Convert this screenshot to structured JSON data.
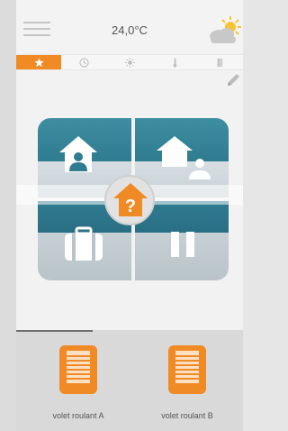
{
  "header": {
    "temperature": "24,0°C",
    "menu_icon": "hamburger-menu-icon",
    "weather_icon": "partly-sunny-icon"
  },
  "tabs": [
    {
      "icon": "star-icon",
      "active": true
    },
    {
      "icon": "clock-icon",
      "active": false
    },
    {
      "icon": "sun-icon",
      "active": false
    },
    {
      "icon": "thermometer-icon",
      "active": false
    },
    {
      "icon": "book-icon",
      "active": false
    }
  ],
  "modes": [
    {
      "icon": "house-person-icon"
    },
    {
      "icon": "house-person-away-icon"
    },
    {
      "icon": "suitcase-icon"
    },
    {
      "icon": "pause-icon"
    }
  ],
  "center": {
    "icon": "house-question-icon",
    "symbol": "?"
  },
  "devices": [
    {
      "label": "volet roulant A",
      "icon": "roller-shutter-icon"
    },
    {
      "label": "volet roulant B",
      "icon": "roller-shutter-icon"
    }
  ],
  "colors": {
    "accent": "#f08a24",
    "mode_blue": "#2f7b90",
    "mode_grey": "#c7d1d6"
  }
}
